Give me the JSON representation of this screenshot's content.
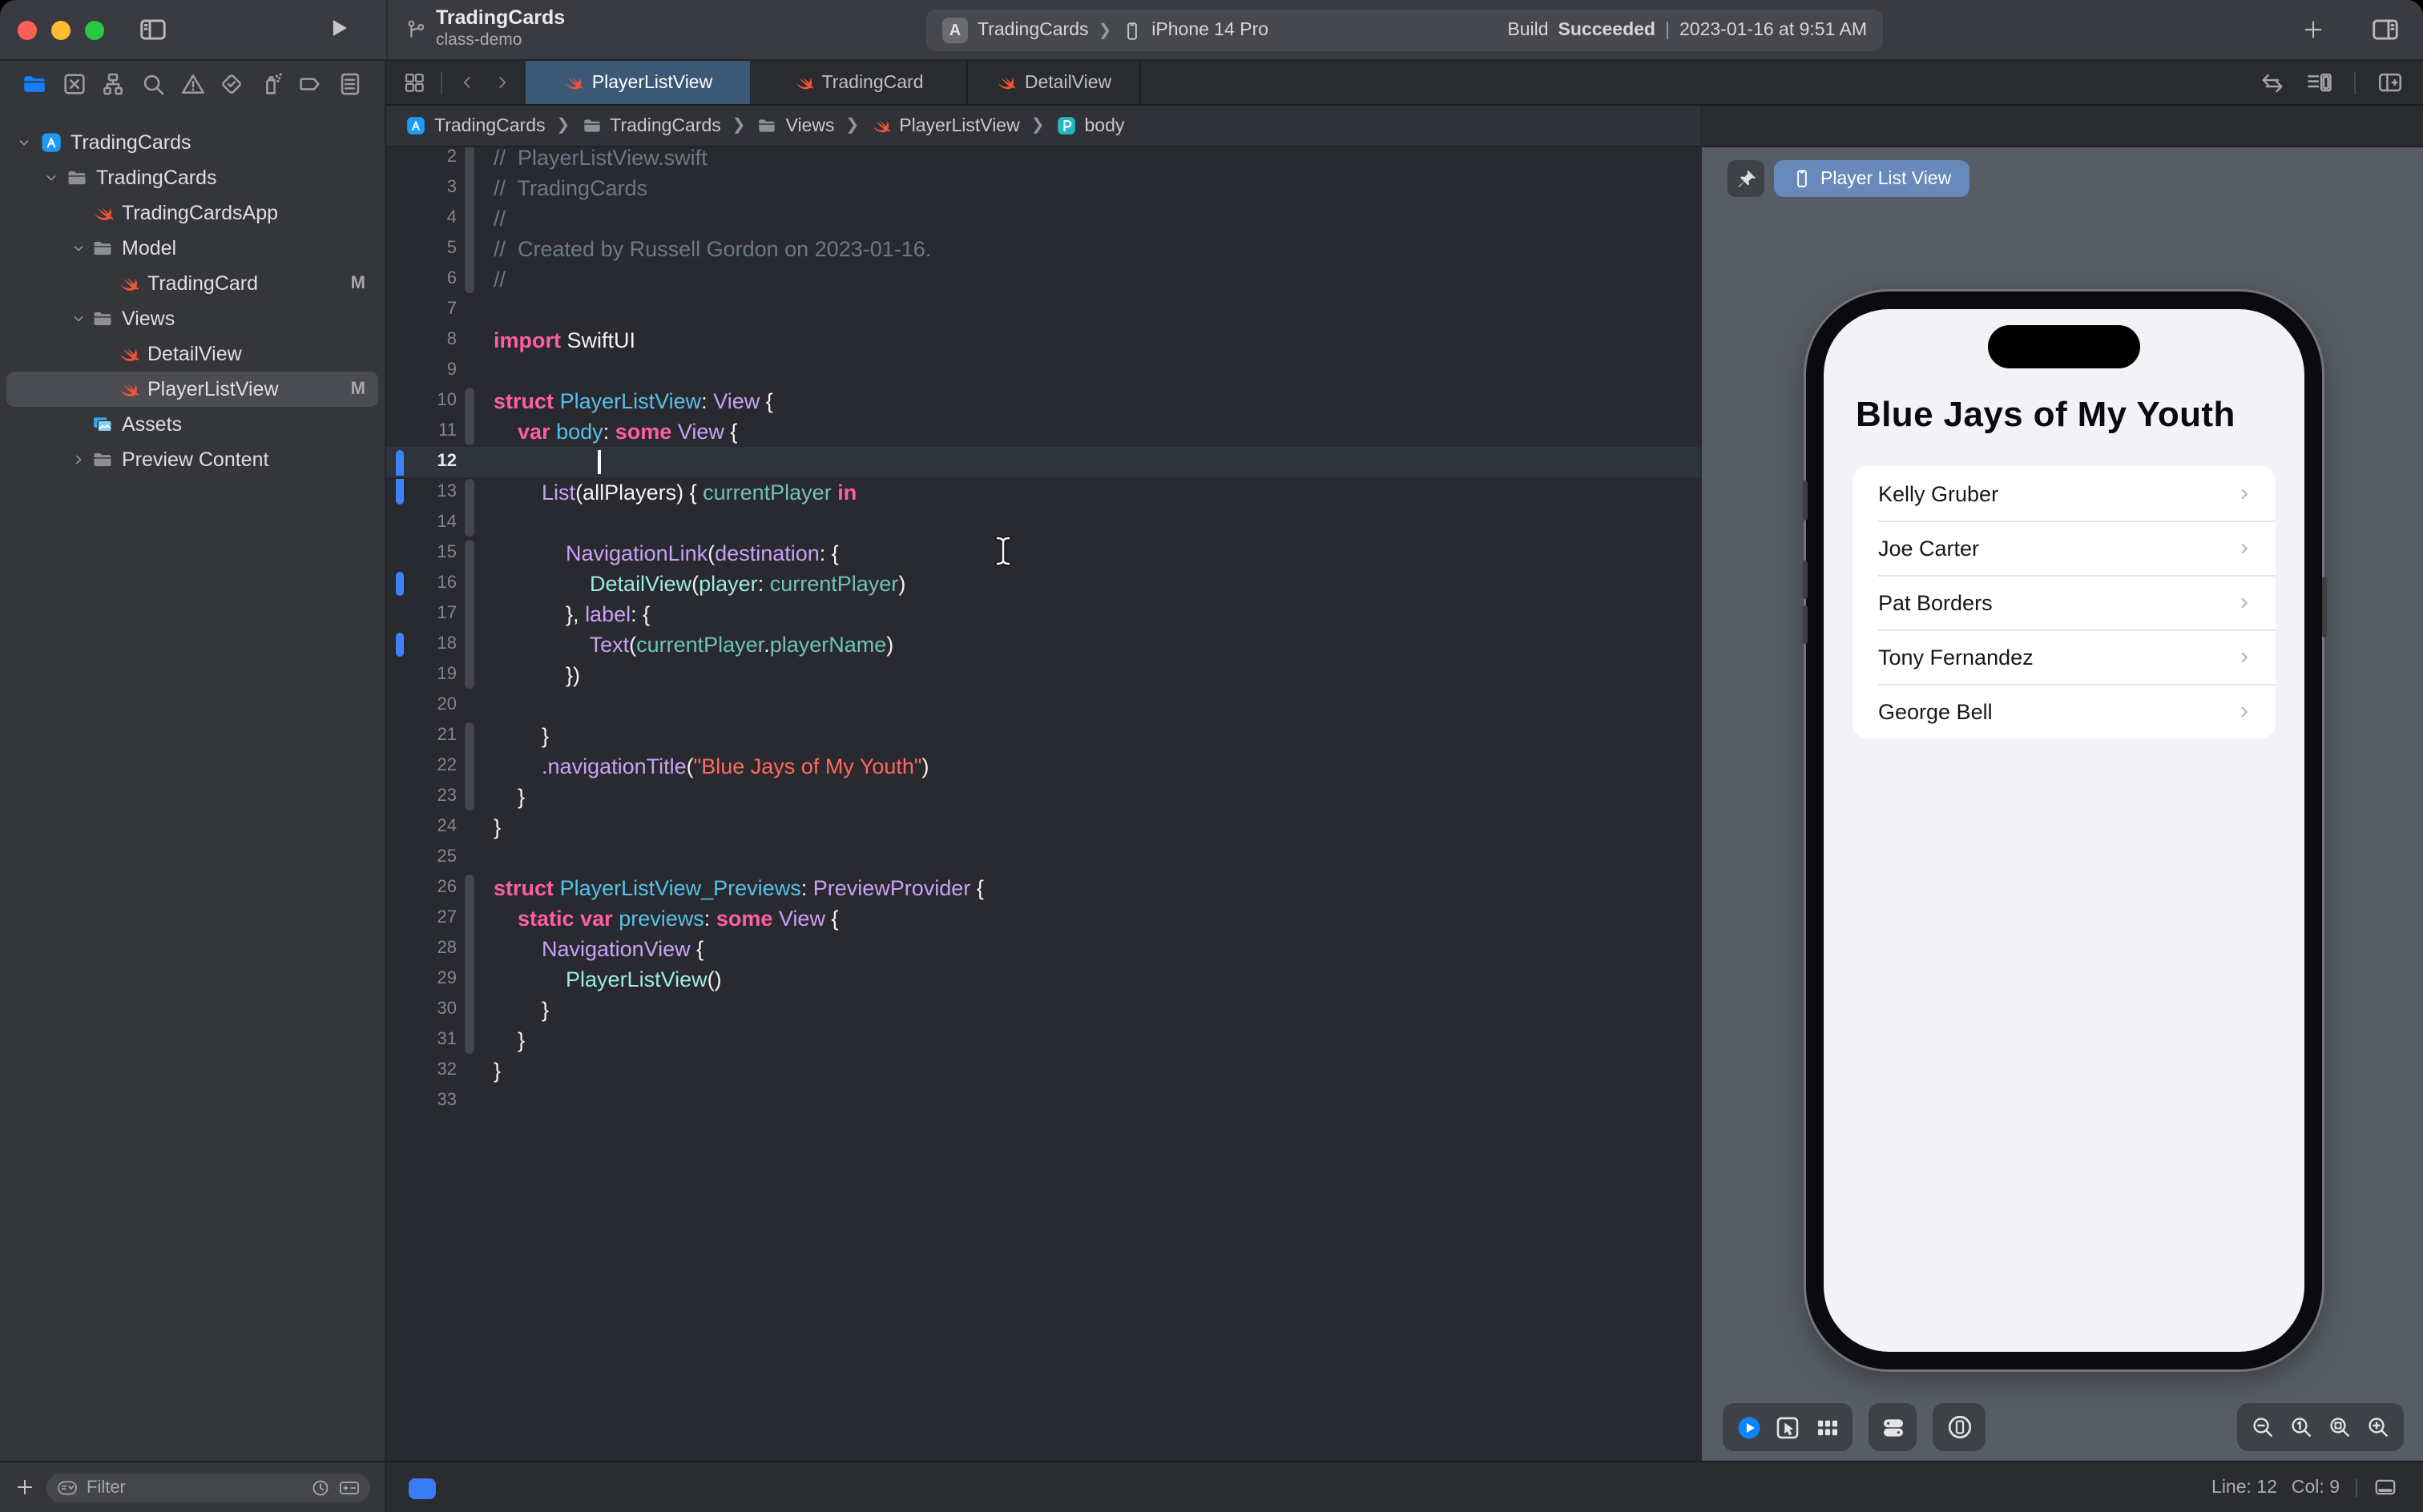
{
  "window": {
    "project": "TradingCards",
    "branch": "class-demo",
    "scheme": {
      "name": "TradingCards",
      "destination": "iPhone 14 Pro"
    },
    "build": {
      "prefix": "Build",
      "result": "Succeeded",
      "separator": "|",
      "timestamp": "2023-01-16 at 9:51 AM"
    }
  },
  "navigator": {
    "icons": [
      {
        "name": "project-navigator-icon",
        "icon": "folderfill",
        "active": true
      },
      {
        "name": "source-control-navigator-icon",
        "icon": "xsquare",
        "active": false
      },
      {
        "name": "symbol-navigator-icon",
        "icon": "hierarchy",
        "active": false
      },
      {
        "name": "find-navigator-icon",
        "icon": "search",
        "active": false
      },
      {
        "name": "issue-navigator-icon",
        "icon": "warning",
        "active": false
      },
      {
        "name": "test-navigator-icon",
        "icon": "diamondcheck",
        "active": false
      },
      {
        "name": "debug-navigator-icon",
        "icon": "spray",
        "active": false
      },
      {
        "name": "breakpoint-navigator-icon",
        "icon": "tag",
        "active": false
      },
      {
        "name": "report-navigator-icon",
        "icon": "reportdoc",
        "active": false
      }
    ],
    "tree": [
      {
        "depth": 0,
        "icon": "appproj",
        "label": "TradingCards",
        "chevron": "down"
      },
      {
        "depth": 1,
        "icon": "folder",
        "label": "TradingCards",
        "chevron": "down"
      },
      {
        "depth": 2,
        "icon": "swift",
        "label": "TradingCardsApp"
      },
      {
        "depth": 2,
        "icon": "folder",
        "label": "Model",
        "chevron": "down"
      },
      {
        "depth": 3,
        "icon": "swift",
        "label": "TradingCard",
        "badge": "M"
      },
      {
        "depth": 2,
        "icon": "folder",
        "label": "Views",
        "chevron": "down"
      },
      {
        "depth": 3,
        "icon": "swift",
        "label": "DetailView"
      },
      {
        "depth": 3,
        "icon": "swift",
        "label": "PlayerListView",
        "badge": "M",
        "selected": true
      },
      {
        "depth": 2,
        "icon": "assets",
        "label": "Assets"
      },
      {
        "depth": 2,
        "icon": "folder",
        "label": "Preview Content",
        "chevron": "right"
      }
    ],
    "filter": {
      "placeholder": "Filter"
    }
  },
  "editor": {
    "tabs": [
      {
        "label": "PlayerListView",
        "active": true
      },
      {
        "label": "TradingCard",
        "active": false
      },
      {
        "label": "DetailView",
        "active": false
      }
    ],
    "breadcrumbs": [
      {
        "icon": "appproj",
        "label": "TradingCards"
      },
      {
        "icon": "folder",
        "label": "TradingCards"
      },
      {
        "icon": "folder",
        "label": "Views"
      },
      {
        "icon": "swift",
        "label": "PlayerListView"
      },
      {
        "icon": "pbadge",
        "label": "body"
      }
    ],
    "code": {
      "first_line": 2,
      "current_line": 12,
      "caret": {
        "line": 12,
        "col": 9
      },
      "change_marks": [
        [
          12,
          13
        ],
        [
          16,
          16
        ],
        [
          18,
          18
        ]
      ],
      "fold_segments": [
        [
          2,
          6
        ],
        [
          10,
          11
        ],
        [
          13,
          14
        ],
        [
          15,
          19
        ],
        [
          21,
          23
        ],
        [
          26,
          31
        ]
      ],
      "lines": [
        {
          "n": 2,
          "segs": [
            [
              "cm",
              "//  PlayerListView.swift"
            ]
          ]
        },
        {
          "n": 3,
          "segs": [
            [
              "cm",
              "//  TradingCards"
            ]
          ]
        },
        {
          "n": 4,
          "segs": [
            [
              "cm",
              "//"
            ]
          ]
        },
        {
          "n": 5,
          "segs": [
            [
              "cm",
              "//  Created by Russell Gordon on 2023-01-16."
            ]
          ]
        },
        {
          "n": 6,
          "segs": [
            [
              "cm",
              "//"
            ]
          ]
        },
        {
          "n": 7,
          "segs": []
        },
        {
          "n": 8,
          "segs": [
            [
              "kw",
              "import"
            ],
            [
              "pl",
              " SwiftUI"
            ]
          ]
        },
        {
          "n": 9,
          "segs": []
        },
        {
          "n": 10,
          "segs": [
            [
              "kw",
              "struct"
            ],
            [
              "pl",
              " "
            ],
            [
              "decl",
              "PlayerListView"
            ],
            [
              "pl",
              ": "
            ],
            [
              "type",
              "View"
            ],
            [
              "pl",
              " {"
            ]
          ]
        },
        {
          "n": 11,
          "segs": [
            [
              "pl",
              "    "
            ],
            [
              "kw",
              "var"
            ],
            [
              "pl",
              " "
            ],
            [
              "decl",
              "body"
            ],
            [
              "pl",
              ": "
            ],
            [
              "kw",
              "some"
            ],
            [
              "pl",
              " "
            ],
            [
              "type",
              "View"
            ],
            [
              "pl",
              " {"
            ]
          ]
        },
        {
          "n": 12,
          "segs": []
        },
        {
          "n": 13,
          "segs": [
            [
              "pl",
              "        "
            ],
            [
              "type",
              "List"
            ],
            [
              "pl",
              "(allPlayers) { "
            ],
            [
              "proj",
              "currentPlayer"
            ],
            [
              "pl",
              " "
            ],
            [
              "kw",
              "in"
            ]
          ]
        },
        {
          "n": 14,
          "segs": []
        },
        {
          "n": 15,
          "segs": [
            [
              "pl",
              "            "
            ],
            [
              "type",
              "NavigationLink"
            ],
            [
              "pl",
              "("
            ],
            [
              "type",
              "destination"
            ],
            [
              "pl",
              ": {"
            ]
          ]
        },
        {
          "n": 16,
          "segs": [
            [
              "pl",
              "                "
            ],
            [
              "mint",
              "DetailView"
            ],
            [
              "pl",
              "("
            ],
            [
              "mint",
              "player"
            ],
            [
              "pl",
              ": "
            ],
            [
              "proj",
              "currentPlayer"
            ],
            [
              "pl",
              ")"
            ]
          ]
        },
        {
          "n": 17,
          "segs": [
            [
              "pl",
              "            }, "
            ],
            [
              "type",
              "label"
            ],
            [
              "pl",
              ": {"
            ]
          ]
        },
        {
          "n": 18,
          "segs": [
            [
              "pl",
              "                "
            ],
            [
              "type",
              "Text"
            ],
            [
              "pl",
              "("
            ],
            [
              "proj",
              "currentPlayer"
            ],
            [
              "pl",
              "."
            ],
            [
              "proj",
              "playerName"
            ],
            [
              "pl",
              ")"
            ]
          ]
        },
        {
          "n": 19,
          "segs": [
            [
              "pl",
              "            })"
            ]
          ]
        },
        {
          "n": 20,
          "segs": []
        },
        {
          "n": 21,
          "segs": [
            [
              "pl",
              "        }"
            ]
          ]
        },
        {
          "n": 22,
          "segs": [
            [
              "pl",
              "        "
            ],
            [
              "type",
              ".navigationTitle"
            ],
            [
              "pl",
              "("
            ],
            [
              "str",
              "\"Blue Jays of My Youth\""
            ],
            [
              "pl",
              ")"
            ]
          ]
        },
        {
          "n": 23,
          "segs": [
            [
              "pl",
              "    }"
            ]
          ]
        },
        {
          "n": 24,
          "segs": [
            [
              "pl",
              "}"
            ]
          ]
        },
        {
          "n": 25,
          "segs": []
        },
        {
          "n": 26,
          "segs": [
            [
              "kw",
              "struct"
            ],
            [
              "pl",
              " "
            ],
            [
              "decl",
              "PlayerListView_Previews"
            ],
            [
              "pl",
              ": "
            ],
            [
              "type",
              "PreviewProvider"
            ],
            [
              "pl",
              " {"
            ]
          ]
        },
        {
          "n": 27,
          "segs": [
            [
              "pl",
              "    "
            ],
            [
              "kw",
              "static"
            ],
            [
              "pl",
              " "
            ],
            [
              "kw",
              "var"
            ],
            [
              "pl",
              " "
            ],
            [
              "decl",
              "previews"
            ],
            [
              "pl",
              ": "
            ],
            [
              "kw",
              "some"
            ],
            [
              "pl",
              " "
            ],
            [
              "type",
              "View"
            ],
            [
              "pl",
              " {"
            ]
          ]
        },
        {
          "n": 28,
          "segs": [
            [
              "pl",
              "        "
            ],
            [
              "type",
              "NavigationView"
            ],
            [
              "pl",
              " {"
            ]
          ]
        },
        {
          "n": 29,
          "segs": [
            [
              "pl",
              "            "
            ],
            [
              "mint",
              "PlayerListView"
            ],
            [
              "pl",
              "()"
            ]
          ]
        },
        {
          "n": 30,
          "segs": [
            [
              "pl",
              "        }"
            ]
          ]
        },
        {
          "n": 31,
          "segs": [
            [
              "pl",
              "    }"
            ]
          ]
        },
        {
          "n": 32,
          "segs": [
            [
              "pl",
              "}"
            ]
          ]
        },
        {
          "n": 33,
          "segs": []
        }
      ]
    },
    "status": {
      "line": "Line: 12",
      "col": "Col: 9"
    }
  },
  "canvas": {
    "pill_label": "Player List View",
    "preview": {
      "nav_title": "Blue Jays of My Youth",
      "players": [
        "Kelly Gruber",
        "Joe Carter",
        "Pat Borders",
        "Tony Fernandez",
        "George Bell"
      ]
    },
    "toolbar_groups": {
      "mode": [
        "playblue",
        "pointer",
        "grid6"
      ],
      "settings": [
        "toggles"
      ],
      "device": [
        "devicecircle"
      ],
      "zoom": [
        "magminus",
        "mag1",
        "magfit",
        "magplus"
      ]
    }
  },
  "colors": {
    "accent_blue": "#157EFB",
    "active_tab": "#3B5876",
    "swift_orange": "#F05138",
    "build_pill": "#47484D",
    "canvas_bg": "#575D64"
  }
}
